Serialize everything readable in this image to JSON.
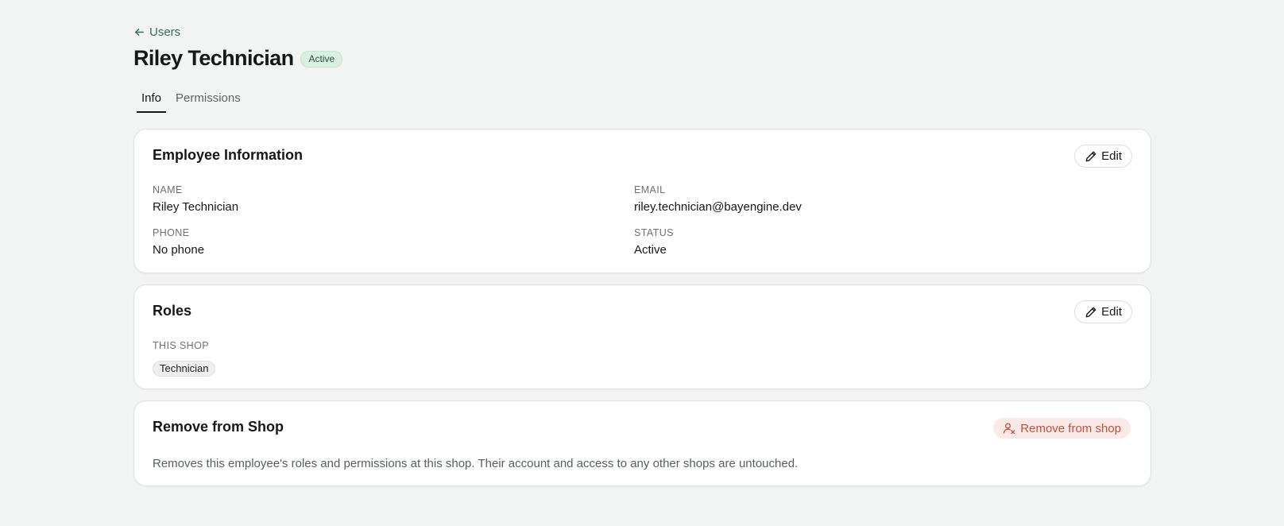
{
  "back_link": {
    "label": "Users",
    "icon": "arrow-left-icon"
  },
  "header": {
    "title": "Riley Technician",
    "status": "Active"
  },
  "tabs": [
    {
      "label": "Info",
      "active": true
    },
    {
      "label": "Permissions",
      "active": false
    }
  ],
  "employee_info": {
    "title": "Employee Information",
    "edit_label": "Edit",
    "fields": {
      "name": {
        "label": "NAME",
        "value": "Riley Technician"
      },
      "email": {
        "label": "EMAIL",
        "value": "riley.technician@bayengine.dev"
      },
      "phone": {
        "label": "PHONE",
        "value": "No phone"
      },
      "status": {
        "label": "STATUS",
        "value": "Active"
      }
    }
  },
  "roles": {
    "title": "Roles",
    "edit_label": "Edit",
    "section_label": "THIS SHOP",
    "items": [
      "Technician"
    ]
  },
  "remove": {
    "title": "Remove from Shop",
    "button_label": "Remove from shop",
    "description": "Removes this employee's roles and permissions at this shop. Their account and access to any other shops are untouched."
  },
  "colors": {
    "accent_green": "#3a6e56",
    "status_bg": "#d9efdf",
    "danger": "#c0503f",
    "danger_bg": "#fbe9e7",
    "page_bg": "#f2f4f3"
  }
}
